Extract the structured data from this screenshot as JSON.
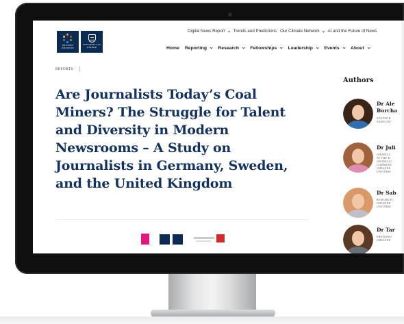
{
  "logos": {
    "reuters": "REUTERS\nINSTITUTE",
    "oxford": "UNIVERSITY OF\nOXFORD"
  },
  "topnav": {
    "items": [
      {
        "label": "Digital News Report",
        "has_dropdown": true
      },
      {
        "label": "Trends and Predictions",
        "has_dropdown": false
      },
      {
        "label": "Our Climate Network",
        "has_dropdown": true
      },
      {
        "label": "AI and the Future of News",
        "has_dropdown": false
      }
    ]
  },
  "mainnav": {
    "items": [
      {
        "label": "Home",
        "has_dropdown": false
      },
      {
        "label": "Reporting",
        "has_dropdown": true
      },
      {
        "label": "Research",
        "has_dropdown": true
      },
      {
        "label": "Fellowships",
        "has_dropdown": true
      },
      {
        "label": "Leadership",
        "has_dropdown": true
      },
      {
        "label": "Events",
        "has_dropdown": true
      },
      {
        "label": "About",
        "has_dropdown": true
      }
    ]
  },
  "breadcrumb": {
    "label": "REPORTS"
  },
  "article": {
    "title": "Are Journalists Today’s Coal Miners? The Struggle for Talent and Diversity in Modern Newsrooms – A Study on Journalists in Germany, Sweden, and the United Kingdom"
  },
  "authors": {
    "heading": "Authors",
    "list": [
      {
        "name": "Dr Ale\nBorcha",
        "role": "SENIOR R\nASSOCIAT",
        "hair": "#3a2418",
        "body": "#2f6fb0"
      },
      {
        "name": "Dr Juli",
        "role": "JOURNAL\nAT THE D\nJOURNALI\nCOMMUNI\nJOHANNE\nUNIVERSI",
        "hair": "#a0623a",
        "body": "#e08bb0"
      },
      {
        "name": "Dr Sab",
        "role": "RESEARCH\nJOHANNE\nUNIVERSI",
        "hair": "#d99968",
        "body": "#c0c0c8"
      },
      {
        "name": "Dr Tar",
        "role": "PROFESSO\nJOHANNE",
        "hair": "#5a3a22",
        "body": "#6a6f78"
      }
    ]
  },
  "colors": {
    "title": "#13335e",
    "brand_navy": "#0c2b52",
    "partner_pink": "#e5157f",
    "partner_red": "#d32b2b"
  }
}
